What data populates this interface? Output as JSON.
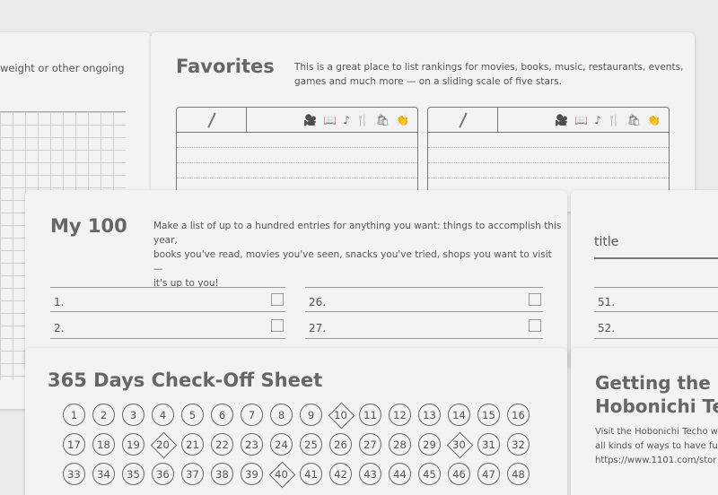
{
  "back_left": {
    "text": "weight or other ongoing"
  },
  "favorites": {
    "title": "Favorites",
    "description_line1": "This is a great place to list rankings for movies, books, music, restaurants, events,",
    "description_line2": "games and much more — on a sliding scale of five stars.",
    "icons": [
      "movie-icon",
      "book-icon",
      "music-icon",
      "restaurant-icon",
      "shopping-bag-icon",
      "clap-icon"
    ]
  },
  "my100": {
    "title": "My 100",
    "description_line1": "Make a list of up to a hundred entries for anything you want: things to accomplish this year,",
    "description_line2": "books you've read, movies you've seen, snacks you've tried, shops you want to visit —",
    "description_line3": "it's up to you!",
    "left_rows": [
      "1.",
      "2."
    ],
    "mid_rows": [
      "26.",
      "27."
    ],
    "right_rows": [
      "51.",
      "52."
    ],
    "title_field": "title"
  },
  "checkoff": {
    "title": "365 Days Check-Off Sheet",
    "days": [
      "1",
      "2",
      "3",
      "4",
      "5",
      "6",
      "7",
      "8",
      "9",
      "10",
      "11",
      "12",
      "13",
      "14",
      "15",
      "16",
      "17",
      "18",
      "19",
      "20",
      "21",
      "22",
      "23",
      "24",
      "25",
      "26",
      "27",
      "28",
      "29",
      "30",
      "31",
      "32",
      "33",
      "34",
      "35",
      "36",
      "37",
      "38",
      "39",
      "40",
      "41",
      "42",
      "43",
      "44",
      "45",
      "46",
      "47",
      "48"
    ],
    "diamond_days": [
      "10",
      "20",
      "30",
      "40"
    ]
  },
  "getting": {
    "title_line1": "Getting the M",
    "title_line2": "Hobonichi Tec",
    "text_line1": "Visit the Hobonichi Techo w",
    "text_line2": "all kinds of ways to have fun",
    "text_line3": "https://www.1101.com/stor"
  }
}
